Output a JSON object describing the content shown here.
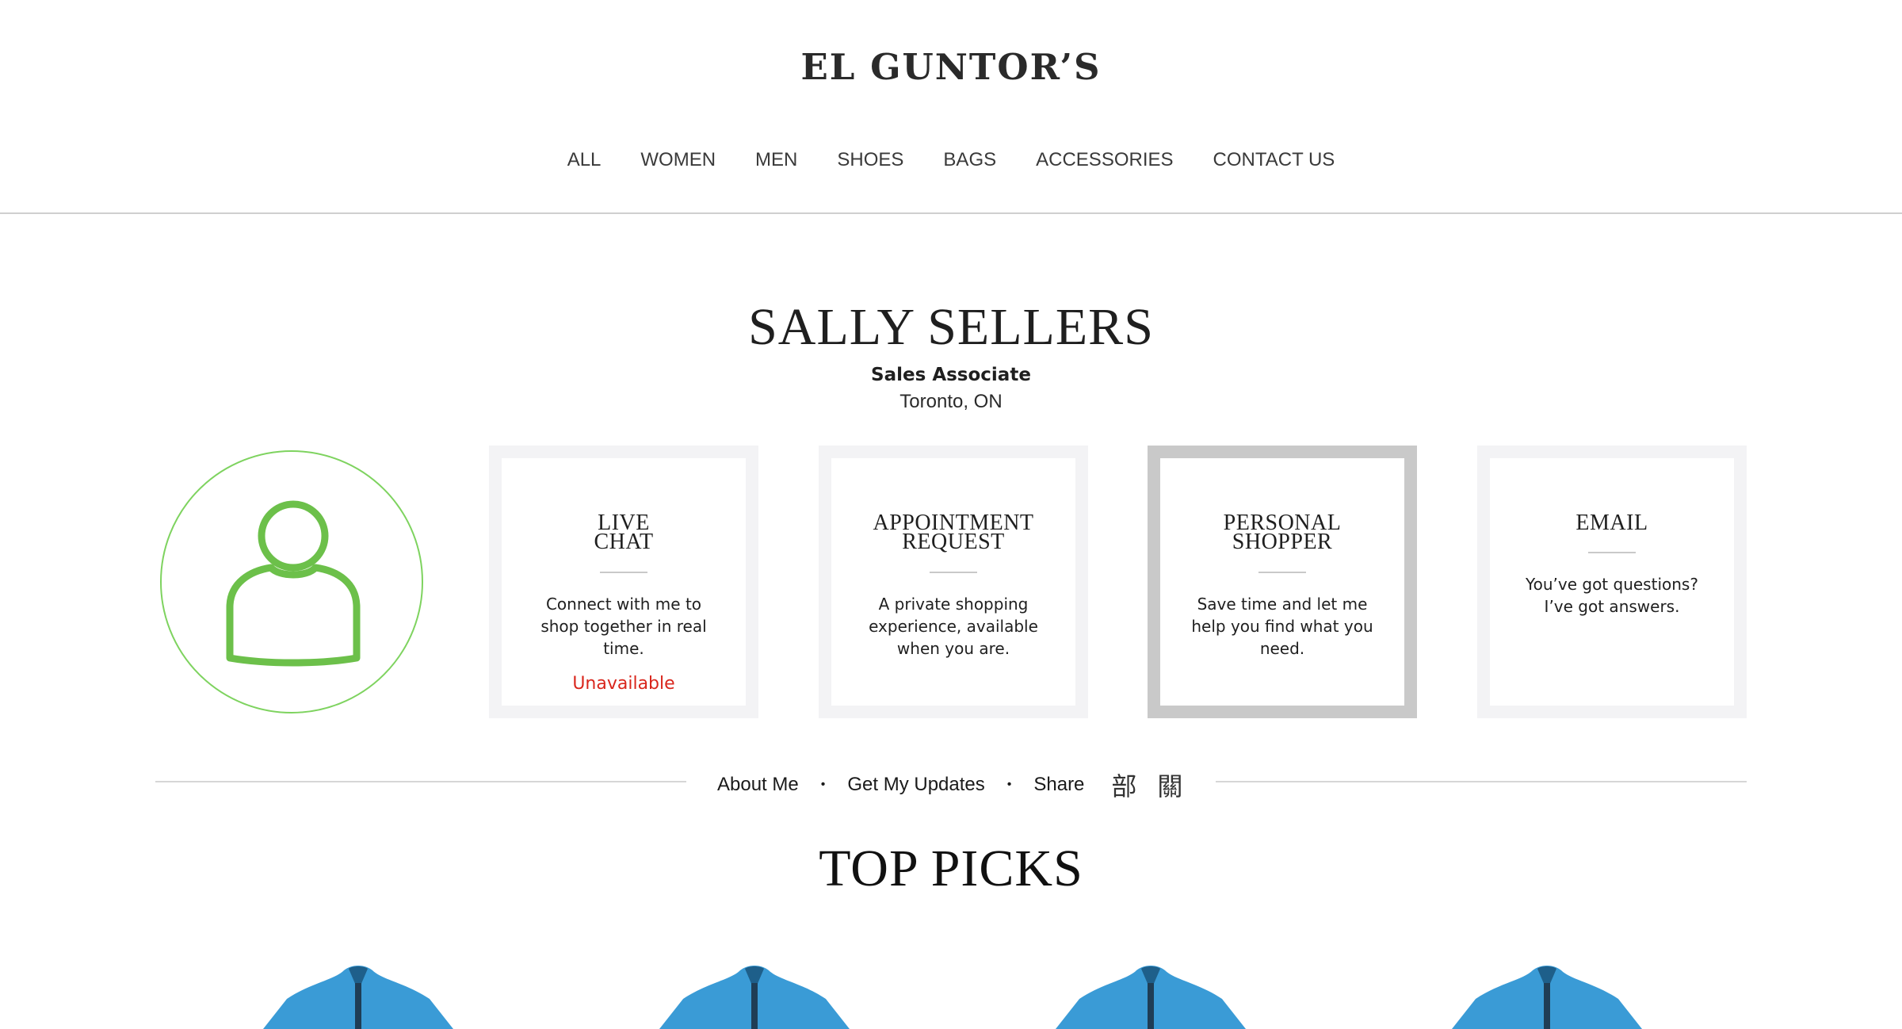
{
  "brand": {
    "logo": "EL GUNTOR’S"
  },
  "nav": {
    "items": [
      "ALL",
      "WOMEN",
      "MEN",
      "SHOES",
      "BAGS",
      "ACCESSORIES",
      "CONTACT US"
    ]
  },
  "profile": {
    "name": "SALLY SELLERS",
    "role": "Sales Associate",
    "location": "Toronto, ON",
    "avatar_icon": "user-outline-icon",
    "accent_color": "#6cc04a"
  },
  "services": [
    {
      "title_line1": "LIVE",
      "title_line2": "CHAT",
      "description": "Connect with me to shop together in real time.",
      "status": "Unavailable"
    },
    {
      "title_line1": "APPOINTMENT",
      "title_line2": "REQUEST",
      "description": "A private shopping experience, available when you are."
    },
    {
      "title_line1": "PERSONAL",
      "title_line2": "SHOPPER",
      "description": "Save time and let me help you find what you need."
    },
    {
      "title_line1": "EMAIL",
      "title_line2": "",
      "description": "You’ve got questions? I’ve got answers."
    }
  ],
  "links": {
    "about": "About Me",
    "updates": "Get My Updates",
    "share": "Share",
    "share_icon_1": "部",
    "share_icon_2": "關",
    "separator": "•"
  },
  "top_picks": {
    "title": "TOP PICKS",
    "product_icon": "jacket-icon",
    "product_color": "#3a9bd6"
  },
  "colors": {
    "status_unavailable": "#d9261c",
    "card_border": "#f3f3f5",
    "card_border_active": "#c9c9c9"
  }
}
